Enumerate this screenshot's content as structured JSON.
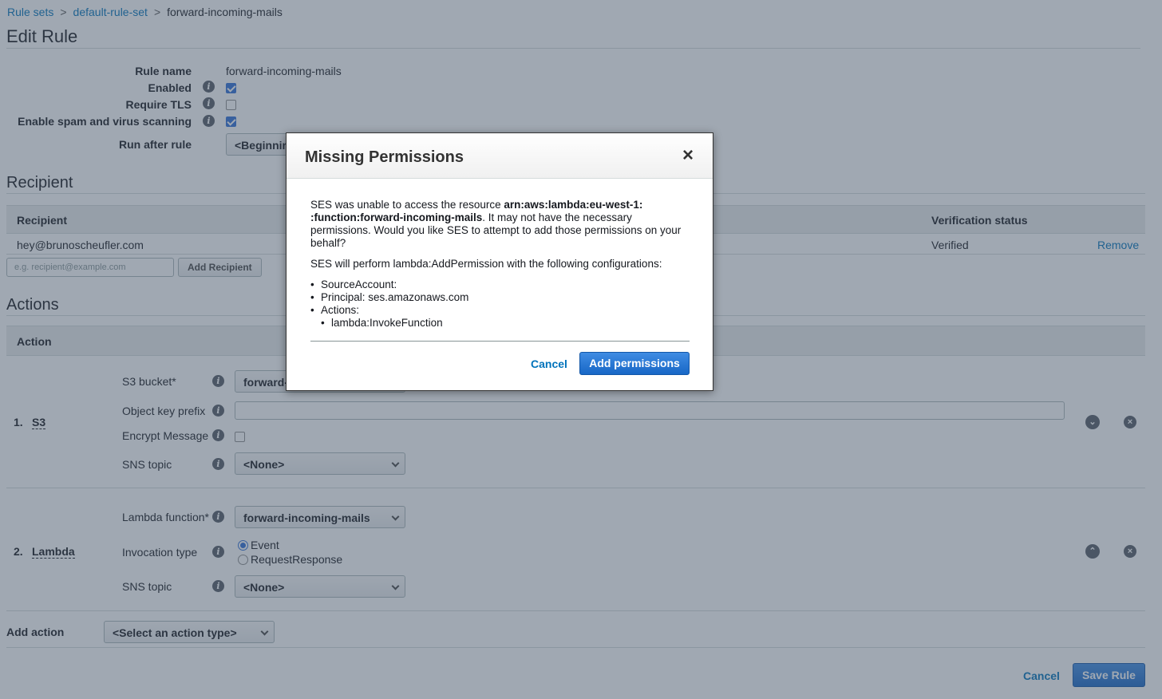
{
  "breadcrumb": {
    "items": [
      "Rule sets",
      "default-rule-set",
      "forward-incoming-mails"
    ],
    "separator": ">"
  },
  "page_title": "Edit Rule",
  "rule": {
    "name_label": "Rule name",
    "name_value": "forward-incoming-mails",
    "enabled_label": "Enabled",
    "enabled": true,
    "require_tls_label": "Require TLS",
    "require_tls": false,
    "spam_label": "Enable spam and virus scanning",
    "spam": true,
    "run_after_label": "Run after rule",
    "run_after_value": "<Beginning of list>"
  },
  "recipient": {
    "section_title": "Recipient",
    "col_recipient": "Recipient",
    "col_status": "Verification status",
    "rows": [
      {
        "email": "hey@brunoscheufler.com",
        "status": "Verified",
        "action": "Remove"
      }
    ],
    "input_placeholder": "e.g. recipient@example.com",
    "add_button": "Add Recipient"
  },
  "actions": {
    "section_title": "Actions",
    "col_action": "Action",
    "s3": {
      "index": "1.",
      "name": "S3",
      "bucket_label": "S3 bucket*",
      "bucket_value": "forward-incoming-mails",
      "prefix_label": "Object key prefix",
      "prefix_value": "",
      "encrypt_label": "Encrypt Message",
      "encrypt": false,
      "sns_label": "SNS topic",
      "sns_value": "<None>"
    },
    "lambda": {
      "index": "2.",
      "name": "Lambda",
      "function_label": "Lambda function*",
      "function_value": "forward-incoming-mails",
      "invocation_label": "Invocation type",
      "invocation_options": [
        "Event",
        "RequestResponse"
      ],
      "invocation_selected": "Event",
      "sns_label": "SNS topic",
      "sns_value": "<None>"
    },
    "add_action_label": "Add action",
    "add_action_value": "<Select an action type>"
  },
  "footer": {
    "cancel": "Cancel",
    "save": "Save Rule"
  },
  "modal": {
    "title": "Missing Permissions",
    "close_glyph": "×",
    "msg_prefix": "SES was unable to access the resource ",
    "arn": "arn:aws:lambda:eu-west-1:                   :function:forward-incoming-mails",
    "msg_suffix": ". It may not have the necessary permissions. Would you like SES to attempt to add those permissions on your behalf?",
    "config_intro": "SES will perform lambda:AddPermission with the following configurations:",
    "config_items": {
      "source": "SourceAccount:",
      "principal": "Principal: ses.amazonaws.com",
      "actions": "Actions:",
      "action_item": "lambda:InvokeFunction"
    },
    "cancel": "Cancel",
    "confirm": "Add permissions"
  },
  "colors": {
    "link": "#0073bb",
    "primary": "#1867c6",
    "overlay": "rgba(66,82,102,0.5)"
  }
}
